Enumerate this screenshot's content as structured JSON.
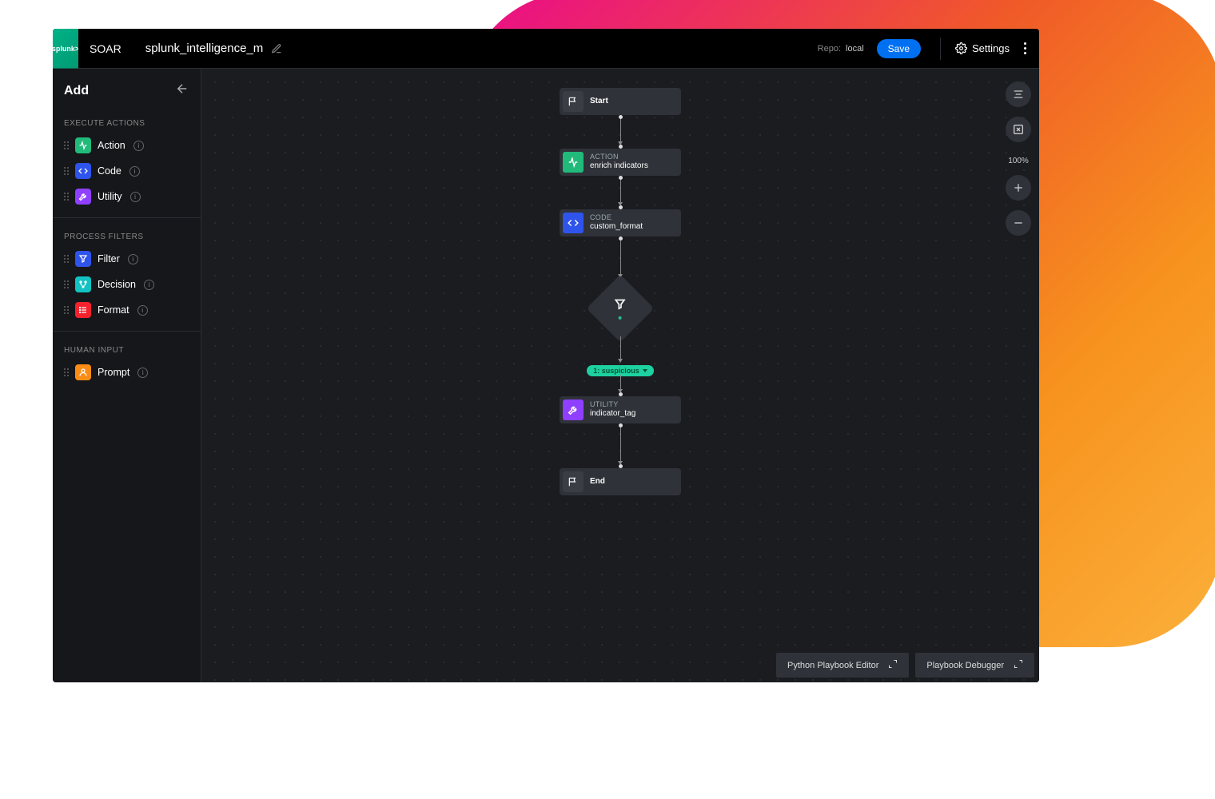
{
  "header": {
    "logo": "splunk>",
    "product": "SOAR",
    "filename": "splunk_intelligence_m",
    "repo_label": "Repo:",
    "repo_value": "local",
    "save_label": "Save",
    "settings_label": "Settings"
  },
  "sidebar": {
    "title": "Add",
    "sections": {
      "execute_actions": {
        "label": "EXECUTE ACTIONS",
        "items": [
          {
            "label": "Action",
            "icon": "pulse",
            "color": "c-green"
          },
          {
            "label": "Code",
            "icon": "code",
            "color": "c-blue"
          },
          {
            "label": "Utility",
            "icon": "wrench",
            "color": "c-purple"
          }
        ]
      },
      "process_filters": {
        "label": "PROCESS FILTERS",
        "items": [
          {
            "label": "Filter",
            "icon": "funnel",
            "color": "c-blue"
          },
          {
            "label": "Decision",
            "icon": "branch",
            "color": "c-teal"
          },
          {
            "label": "Format",
            "icon": "list",
            "color": "c-red"
          }
        ]
      },
      "human_input": {
        "label": "HUMAN INPUT",
        "items": [
          {
            "label": "Prompt",
            "icon": "user",
            "color": "c-orange"
          }
        ]
      }
    }
  },
  "flow": {
    "start": {
      "label": "Start"
    },
    "action": {
      "type": "ACTION",
      "name": "enrich indicators"
    },
    "code": {
      "type": "CODE",
      "name": "custom_format"
    },
    "badge": "1: suspicious",
    "utility": {
      "type": "UTILITY",
      "name": "indicator_tag"
    },
    "end": {
      "label": "End"
    }
  },
  "canvas_controls": {
    "zoom": "100%"
  },
  "bottom": {
    "editor": "Python Playbook Editor",
    "debugger": "Playbook Debugger"
  }
}
